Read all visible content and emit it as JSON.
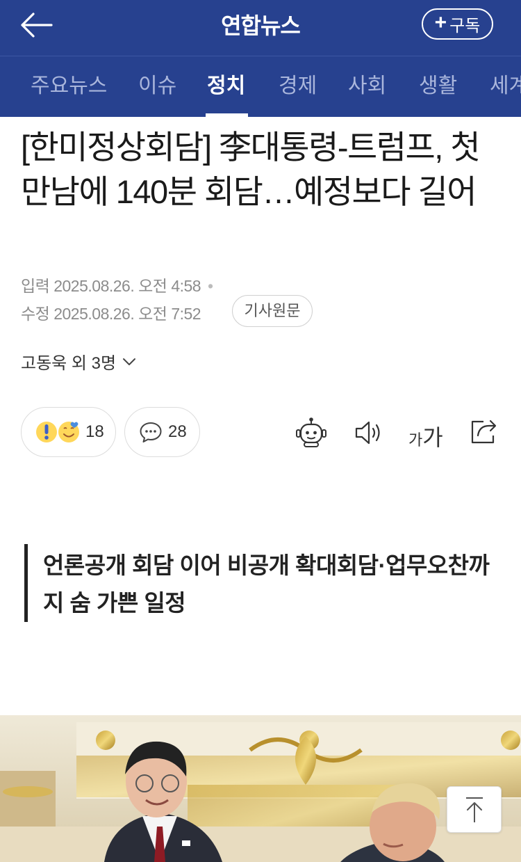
{
  "header": {
    "brand": "연합뉴스",
    "subscribe_label": "구독"
  },
  "tabs": [
    {
      "label": "주요뉴스",
      "active": false
    },
    {
      "label": "이슈",
      "active": false
    },
    {
      "label": "정치",
      "active": true
    },
    {
      "label": "경제",
      "active": false
    },
    {
      "label": "사회",
      "active": false
    },
    {
      "label": "생활",
      "active": false
    },
    {
      "label": "세계",
      "active": false
    }
  ],
  "article": {
    "headline": "[한미정상회담] 李대통령-트럼프, 첫 만남에 140분 회담…예정보다 길어",
    "published_label": "입력",
    "published": "2025.08.26. 오전 4:58",
    "modified_label": "수정",
    "modified": "2025.08.26. 오전 7:52",
    "source_button": "기사원문",
    "authors": "고동욱 외 3명",
    "reaction_count": "18",
    "comment_count": "28",
    "font_small": "가",
    "font_big": "가",
    "subheadline": "언론공개 회담 이어 비공개 확대회담·업무오찬까지 숨 가쁜 일정"
  },
  "icons": {
    "back": "arrow-left-icon",
    "ai": "robot-icon",
    "speaker": "speaker-icon",
    "share": "share-icon",
    "comment": "speech-bubble-icon",
    "scroll_top": "arrow-up-icon"
  },
  "colors": {
    "brand_blue": "#27418f",
    "tab_inactive": "#aab6dc"
  }
}
